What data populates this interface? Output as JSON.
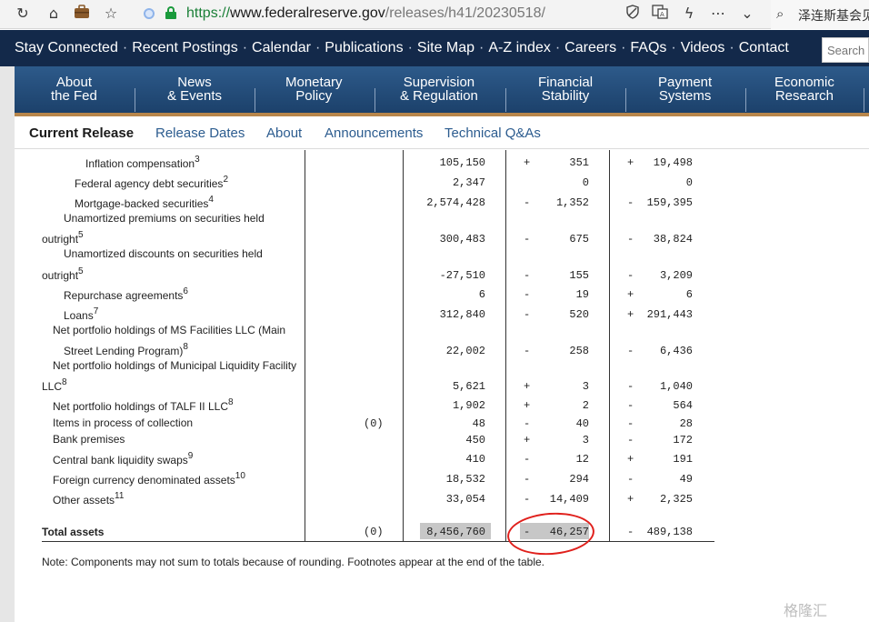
{
  "browser": {
    "url_scheme": "https://",
    "url_host": "www.federalreserve.gov",
    "url_path": "/releases/h41/20230518/",
    "search_text": "泽连斯基会见"
  },
  "topnav": [
    "Stay Connected",
    "Recent Postings",
    "Calendar",
    "Publications",
    "Site Map",
    "A-Z index",
    "Careers",
    "FAQs",
    "Videos",
    "Contact"
  ],
  "site_search_placeholder": "Search",
  "mainnav": [
    {
      "l1": "About",
      "l2": "the Fed"
    },
    {
      "l1": "News",
      "l2": "& Events"
    },
    {
      "l1": "Monetary",
      "l2": "Policy"
    },
    {
      "l1": "Supervision",
      "l2": "& Regulation"
    },
    {
      "l1": "Financial",
      "l2": "Stability"
    },
    {
      "l1": "Payment",
      "l2": "Systems"
    },
    {
      "l1": "Economic",
      "l2": "Research"
    }
  ],
  "subnav": [
    "Current Release",
    "Release Dates",
    "About",
    "Announcements",
    "Technical Q&As"
  ],
  "rows": [
    {
      "label": "Inflation compensation",
      "fn": "3",
      "col1": "",
      "col2": "105,150",
      "s3": "+",
      "col3": "351",
      "s4": "+",
      "col4": "19,498"
    },
    {
      "label": "Federal agency debt securities",
      "fn": "2",
      "col1": "",
      "col2": "2,347",
      "s3": "",
      "col3": "0",
      "s4": "",
      "col4": "0"
    },
    {
      "label": "Mortgage-backed securities",
      "fn": "4",
      "col1": "",
      "col2": "2,574,428",
      "s3": "-",
      "col3": "1,352",
      "s4": "-",
      "col4": "159,395"
    },
    {
      "label": "Unamortized premiums on securities held",
      "label2": "outright",
      "fn": "5",
      "col1": "",
      "col2": "300,483",
      "s3": "-",
      "col3": "675",
      "s4": "-",
      "col4": "38,824"
    },
    {
      "label": "Unamortized discounts on securities held",
      "label2": "outright",
      "fn": "5",
      "col1": "",
      "col2": "-27,510",
      "s3": "-",
      "col3": "155",
      "s4": "-",
      "col4": "3,209"
    },
    {
      "label": "Repurchase agreements",
      "fn": "6",
      "col1": "",
      "col2": "6",
      "s3": "-",
      "col3": "19",
      "s4": "+",
      "col4": "6"
    },
    {
      "label": "Loans",
      "fn": "7",
      "col1": "",
      "col2": "312,840",
      "s3": "-",
      "col3": "520",
      "s4": "+",
      "col4": "291,443"
    },
    {
      "label": "Net portfolio holdings of MS Facilities LLC (Main",
      "label2": "Street Lending Program)",
      "fn": "8",
      "col1": "",
      "col2": "22,002",
      "s3": "-",
      "col3": "258",
      "s4": "-",
      "col4": "6,436"
    },
    {
      "label": "Net portfolio holdings of Municipal Liquidity Facility",
      "label2": "LLC",
      "fn": "8",
      "col1": "",
      "col2": "5,621",
      "s3": "+",
      "col3": "3",
      "s4": "-",
      "col4": "1,040"
    },
    {
      "label": "Net portfolio holdings of TALF II LLC",
      "fn": "8",
      "col1": "",
      "col2": "1,902",
      "s3": "+",
      "col3": "2",
      "s4": "-",
      "col4": "564"
    },
    {
      "label": "Items in process of collection",
      "fn": "",
      "col1": "(0)",
      "col2": "48",
      "s3": "-",
      "col3": "40",
      "s4": "-",
      "col4": "28"
    },
    {
      "label": "Bank premises",
      "fn": "",
      "col1": "",
      "col2": "450",
      "s3": "+",
      "col3": "3",
      "s4": "-",
      "col4": "172"
    },
    {
      "label": "Central bank liquidity swaps",
      "fn": "9",
      "col1": "",
      "col2": "410",
      "s3": "-",
      "col3": "12",
      "s4": "+",
      "col4": "191"
    },
    {
      "label": "Foreign currency denominated assets",
      "fn": "10",
      "col1": "",
      "col2": "18,532",
      "s3": "-",
      "col3": "294",
      "s4": "-",
      "col4": "49"
    },
    {
      "label": "Other assets",
      "fn": "11",
      "col1": "",
      "col2": "33,054",
      "s3": "-",
      "col3": "14,409",
      "s4": "+",
      "col4": "2,325"
    }
  ],
  "total": {
    "label": "Total assets",
    "col1": "(0)",
    "col2": "8,456,760",
    "s3": "-",
    "col3": "46,257",
    "s4": "-",
    "col4": "489,138"
  },
  "note": "Note: Components may not sum to totals because of rounding. Footnotes appear at the end of the table.",
  "watermark": "格隆汇"
}
